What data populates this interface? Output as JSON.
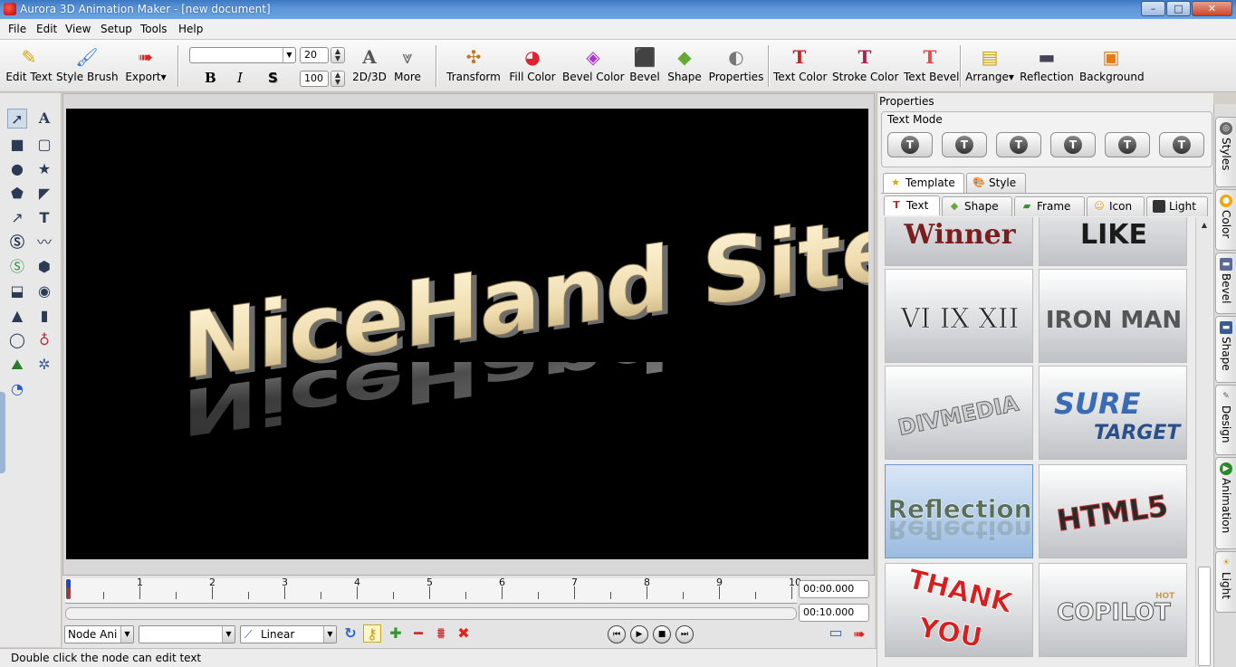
{
  "window": {
    "title": "Aurora 3D Animation Maker - [new document]",
    "min": "–",
    "max": "□",
    "close": "✕"
  },
  "menu": [
    "File",
    "Edit",
    "View",
    "Setup",
    "Tools",
    "Help"
  ],
  "toolbar": {
    "edit_text": "Edit Text",
    "style_brush": "Style Brush",
    "export": "Export",
    "font_size": "20",
    "depth": "100",
    "bold": "B",
    "italic": "I",
    "shadow": "S",
    "mode_2d3d": "2D/3D",
    "more": "More",
    "transform": "Transform",
    "fill_color": "Fill Color",
    "bevel_color": "Bevel Color",
    "bevel": "Bevel",
    "shape": "Shape",
    "properties": "Properties",
    "text_color": "Text Color",
    "stroke_color": "Stroke Color",
    "text_bevel": "Text Bevel",
    "arrange": "Arrange",
    "reflection": "Reflection",
    "background": "Background"
  },
  "canvas": {
    "text": "NiceHand Site"
  },
  "timeline": {
    "ticks": [
      "1",
      "2",
      "3",
      "4",
      "5",
      "6",
      "7",
      "8",
      "9",
      "10"
    ],
    "current_time": "00:00.000",
    "total_time": "00:10.000",
    "node_combo": "Node Ani",
    "second_combo": "",
    "interp_combo": "Linear"
  },
  "status": "Double click the node can edit text",
  "panel": {
    "title": "Properties",
    "text_mode": "Text Mode",
    "tabs": [
      "Template",
      "Style"
    ],
    "subtabs": [
      "Text",
      "Shape",
      "Frame",
      "Icon",
      "Light"
    ],
    "thumbs": [
      {
        "label": "Winner"
      },
      {
        "label": "LIKE"
      },
      {
        "label": "VI IX XII"
      },
      {
        "label": "IRON MAN"
      },
      {
        "label": "DIVMEDIA"
      },
      {
        "label": "SURE",
        "label2": "TARGET"
      },
      {
        "label": "Reflection"
      },
      {
        "label": "HTML5"
      },
      {
        "label": "THANK",
        "label2": "YOU"
      },
      {
        "label": "COPILOT",
        "label2": "HOT"
      }
    ]
  },
  "sidetabs": [
    "Styles",
    "Color",
    "Bevel",
    "Shape",
    "Design",
    "Animation",
    "Light"
  ]
}
